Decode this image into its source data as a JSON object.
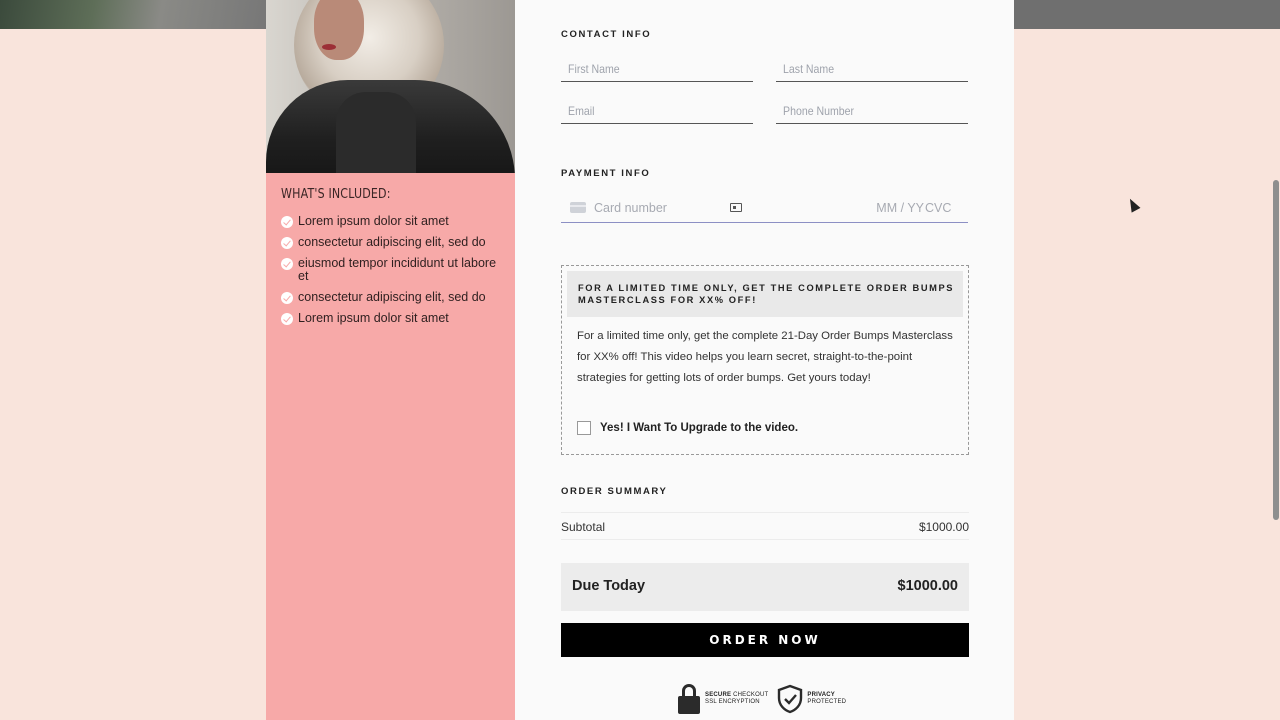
{
  "left": {
    "included_title": "WHAT'S INCLUDED:",
    "items": [
      "Lorem ipsum dolor sit amet",
      "consectetur adipiscing elit, sed do",
      "eiusmod tempor incididunt ut labore et",
      "consectetur adipiscing elit, sed do",
      "Lorem ipsum dolor sit amet"
    ]
  },
  "contact": {
    "label": "CONTACT INFO",
    "first_name_placeholder": "First Name",
    "last_name_placeholder": "Last Name",
    "email_placeholder": "Email",
    "phone_placeholder": "Phone Number"
  },
  "payment": {
    "label": "PAYMENT INFO",
    "card_placeholder": "Card number",
    "exp_placeholder": "MM / YY",
    "cvc_placeholder": "CVC"
  },
  "bump": {
    "heading": "FOR A LIMITED TIME ONLY, GET THE COMPLETE ORDER BUMPS MASTERCLASS FOR XX% OFF!",
    "body": "For a limited time only, get the complete 21-Day Order Bumps Masterclass for XX% off! This video helps you learn secret, straight-to-the-point strategies for getting lots of order bumps. Get yours today!",
    "checkbox_label": "Yes! I Want To Upgrade to the video."
  },
  "summary": {
    "label": "ORDER SUMMARY",
    "subtotal_label": "Subtotal",
    "subtotal_value": "$1000.00",
    "due_label": "Due Today",
    "due_value": "$1000.00"
  },
  "order_button": "ORDER NOW",
  "trust": {
    "secure_bold": "SECURE",
    "secure_rest": "CHECKOUT",
    "ssl": "SSL ENCRYPTION",
    "privacy": "PRIVACY",
    "protected": "PROTECTED"
  },
  "icons": [
    "check-icon",
    "card-brand-icon",
    "autofill-card-icon",
    "lock-icon",
    "shield-check-icon",
    "mouse-cursor-icon"
  ],
  "colors": {
    "left_bg": "#f7a9a8",
    "page_bg": "#f9e4dc",
    "button_bg": "#000000"
  }
}
